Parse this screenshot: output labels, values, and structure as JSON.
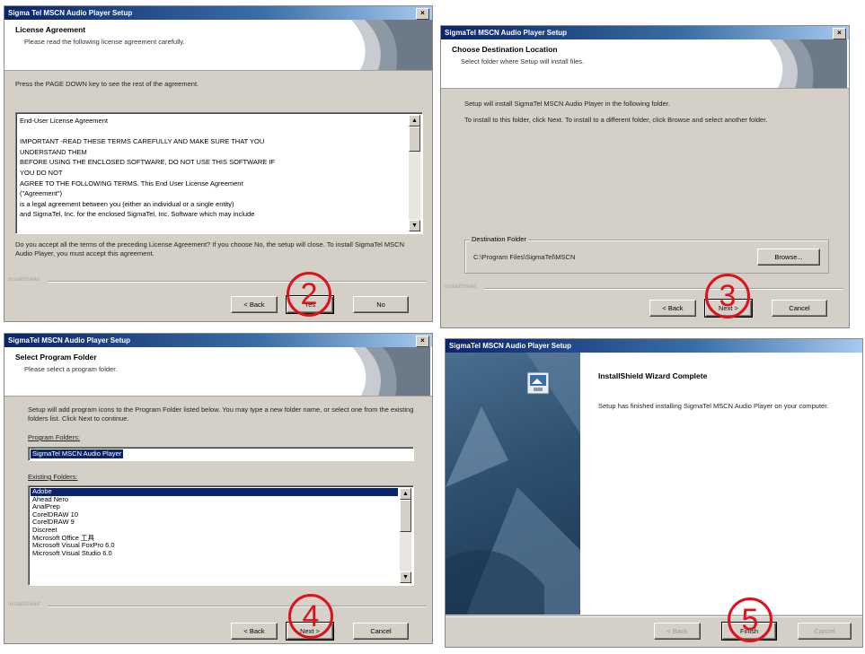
{
  "w2": {
    "title": "Sigma Tel MSCN Audio Player Setup",
    "close": "×",
    "header_title": "License Agreement",
    "header_sub": "Please read the following license agreement carefully.",
    "hint": "Press the PAGE DOWN key to see the rest of the agreement.",
    "license_lines": [
      "End-User License Agreement",
      "",
      "IMPORTANT -READ THESE TERMS CAREFULLY AND MAKE SURE THAT YOU",
      "UNDERSTAND THEM",
      "BEFORE USING THE ENCLOSED SOFTWARE, DO NOT USE THIS SOFTWARE IF",
      "YOU DO NOT",
      "AGREE TO THE FOLLOWING TERMS.  This End User License Agreement",
      "(\"Agreement\")",
      "is a legal agreement between you (either an individual or a single entity)",
      "and SigmaTel, Inc. for the enclosed SigmaTel, Inc. Software which may include"
    ],
    "question": "Do you accept all the terms of the preceding License Agreement? If you choose No, the setup will close. To install SigmaTel MSCN Audio Player, you must accept this agreement.",
    "brand": "InstallShield",
    "back": "< Back",
    "yes": "Yes",
    "no": "No",
    "step": "2"
  },
  "w3": {
    "title": "SigmaTel MSCN Audio Player Setup",
    "close": "×",
    "header_title": "Choose Destination Location",
    "header_sub": "Select folder where Setup will install files.",
    "line1": "Setup will install SigmaTel MSCN Audio Player in the following folder.",
    "line2": "To install to this folder, click Next. To install to a different folder, click Browse and select another folder.",
    "group_label": "Destination Folder",
    "folder_path": "C:\\Program Files\\SigmaTel\\MSCN",
    "browse": "Browse...",
    "brand": "InstallShield",
    "back": "< Back",
    "next": "Next >",
    "cancel": "Cancel",
    "step": "3"
  },
  "w4": {
    "title": "SigmaTel MSCN Audio Player Setup",
    "close": "×",
    "header_title": "Select Program Folder",
    "header_sub": "Please select a program folder.",
    "intro": "Setup will add program icons to the Program Folder listed below. You may type a new folder name, or select one from the existing folders list. Click Next to continue.",
    "program_folder_label": "Program Folders:",
    "program_folder_value": "SigmaTel MSCN Audio Player",
    "existing_label": "Existing Folders:",
    "folders": [
      "Adobe",
      "Ahead Nero",
      "AnalPrep",
      "CorelDRAW 10",
      "CorelDRAW 9",
      "Discreet",
      "Microsoft Office 工具",
      "Microsoft Visual FoxPro 6.0",
      "Microsoft Visual Studio 6.0"
    ],
    "brand": "InstallShield",
    "back": "< Back",
    "next": "Next >",
    "cancel": "Cancel",
    "step": "4"
  },
  "w5": {
    "title": "SigmaTel MSCN Audio Player Setup",
    "heading": "InstallShield Wizard Complete",
    "message": "Setup has finished installing SigmaTel MSCN Audio Player on your computer.",
    "back": "< Back",
    "finish": "Finish",
    "cancel": "Cancel",
    "step": "5"
  }
}
